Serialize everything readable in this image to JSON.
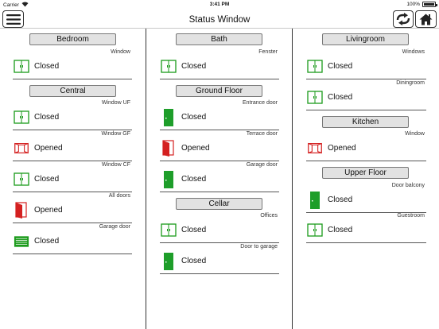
{
  "statusbar": {
    "carrier": "Carrier",
    "time": "3:41 PM",
    "battery": "100%"
  },
  "navbar": {
    "title": "Status Window"
  },
  "columns": [
    {
      "sections": [
        {
          "room": "Bedroom",
          "items": [
            {
              "name": "Window",
              "state": "Closed",
              "icon": "window-closed-icon"
            }
          ]
        },
        {
          "room": "Central",
          "items": [
            {
              "name": "Window UF",
              "state": "Closed",
              "icon": "window-closed-icon"
            },
            {
              "name": "Window GF",
              "state": "Opened",
              "icon": "window-open-icon"
            },
            {
              "name": "Window CF",
              "state": "Closed",
              "icon": "window-closed-icon"
            },
            {
              "name": "All doors",
              "state": "Opened",
              "icon": "door-open-icon"
            },
            {
              "name": "Garage door",
              "state": "Closed",
              "icon": "garage-door-icon"
            }
          ]
        }
      ]
    },
    {
      "sections": [
        {
          "room": "Bath",
          "items": [
            {
              "name": "Fenster",
              "state": "Closed",
              "icon": "window-closed-icon"
            }
          ]
        },
        {
          "room": "Ground Floor",
          "items": [
            {
              "name": "Entrance door",
              "state": "Closed",
              "icon": "door-closed-icon"
            },
            {
              "name": "Terrace door",
              "state": "Opened",
              "icon": "door-open-icon"
            },
            {
              "name": "Garage door",
              "state": "Closed",
              "icon": "door-closed-icon"
            }
          ]
        },
        {
          "room": "Cellar",
          "items": [
            {
              "name": "Offices",
              "state": "Closed",
              "icon": "window-closed-icon"
            },
            {
              "name": "Door to garage",
              "state": "Closed",
              "icon": "door-closed-icon"
            }
          ]
        }
      ]
    },
    {
      "sections": [
        {
          "room": "Livingroom",
          "items": [
            {
              "name": "Windows",
              "state": "Closed",
              "icon": "window-closed-icon"
            },
            {
              "name": "Diningroom",
              "state": "Closed",
              "icon": "window-closed-icon"
            }
          ]
        },
        {
          "room": "Kitchen",
          "items": [
            {
              "name": "Window",
              "state": "Opened",
              "icon": "window-open-icon"
            }
          ]
        },
        {
          "room": "Upper Floor",
          "items": [
            {
              "name": "Door balcony",
              "state": "Closed",
              "icon": "door-closed-icon"
            },
            {
              "name": "Guestroom",
              "state": "Closed",
              "icon": "window-closed-icon"
            }
          ]
        }
      ]
    }
  ],
  "colors": {
    "closed": "#1a9a1a",
    "opened": "#d42020",
    "door_fill": "#1e9e2a"
  }
}
